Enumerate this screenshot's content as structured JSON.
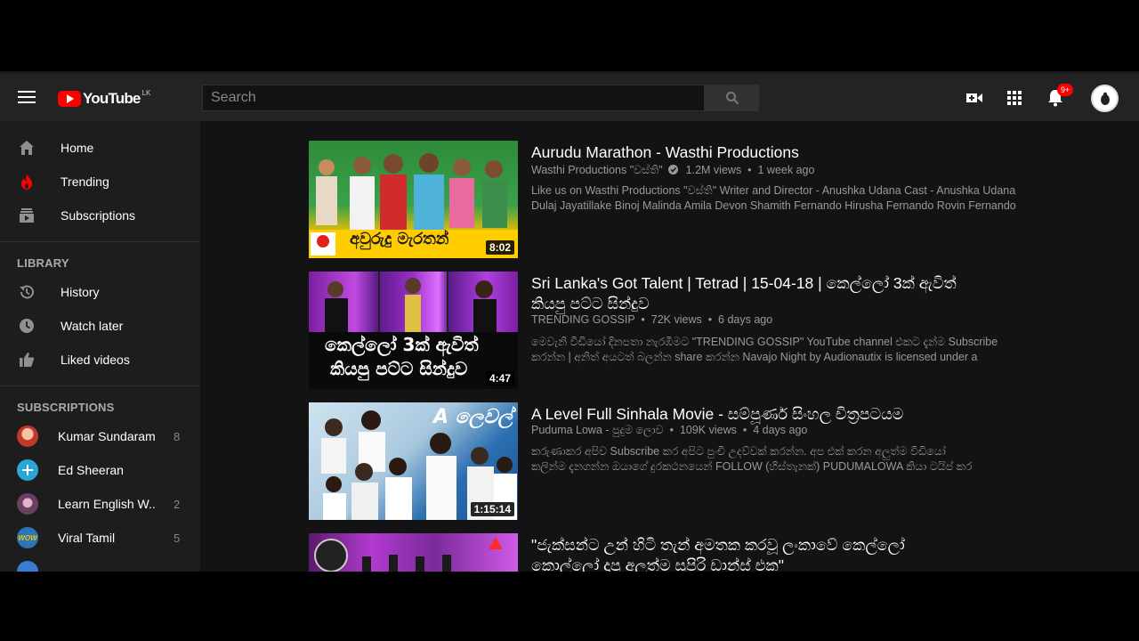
{
  "masthead": {
    "logo_text": "YouTube",
    "country": "LK",
    "search_placeholder": "Search",
    "notification_count": "9+"
  },
  "sidebar": {
    "main_items": [
      {
        "label": "Home",
        "icon": "home-icon"
      },
      {
        "label": "Trending",
        "icon": "flame-icon"
      },
      {
        "label": "Subscriptions",
        "icon": "subscriptions-icon"
      }
    ],
    "library_heading": "LIBRARY",
    "library_items": [
      {
        "label": "History",
        "icon": "history-icon"
      },
      {
        "label": "Watch later",
        "icon": "clock-icon"
      },
      {
        "label": "Liked videos",
        "icon": "thumbs-up-icon"
      }
    ],
    "subscriptions_heading": "SUBSCRIPTIONS",
    "subscriptions": [
      {
        "label": "Kumar Sundaram",
        "count": "8",
        "color": "#d9534f"
      },
      {
        "label": "Ed Sheeran",
        "count": "",
        "color": "#2aa6d8"
      },
      {
        "label": "Learn English W...",
        "count": "2",
        "color": "#7a4f6f"
      },
      {
        "label": "Viral Tamil",
        "count": "5",
        "color": "#f2c500"
      }
    ]
  },
  "videos": [
    {
      "title_line1": "Aurudu Marathon - Wasthi Productions",
      "title_line2": "",
      "channel": "Wasthi Productions \"වස්ති\"",
      "verified": true,
      "views": "1.2M views",
      "age": "1 week ago",
      "desc_line1": "Like us on Wasthi Productions \"වස්ති\" Writer and Director - Anushka Udana Cast - Anushka Udana",
      "desc_line2": "Dulaj Jayatillake Binoj Malinda Amila Devon Shamith Fernando Hirusha Fernando Rovin Fernando",
      "duration": "8:02",
      "thumb_caption": "අවුරුදු මැරතන්"
    },
    {
      "title_line1": "Sri Lanka's Got Talent | Tetrad | 15-04-18 | කෙල්ලෝ 3ක් ඇවිත්",
      "title_line2": "කියපු පට්ට සින්දුව",
      "channel": "TRENDING GOSSIP",
      "verified": false,
      "views": "72K views",
      "age": "6 days ago",
      "desc_line1": "මෙවැනි වීඩියෝ දිනපතා නැරඹීමට \"TRENDING GOSSIP\" YouTube channel එකට දැන්ම Subscribe",
      "desc_line2": "කරන්න | අනිත් අයටත් බලන්න share කරන්න Navajo Night by Audionautix is licensed under a",
      "duration": "4:47",
      "thumb_caption_1": "කෙල්ලෝ 3ක් ඇවිත්",
      "thumb_caption_2": "කියපු පට්ට සින්දුව"
    },
    {
      "title_line1": "A Level Full Sinhala Movie - සම්පූර්ණ සිංහල චිත්‍රපටයම",
      "title_line2": "",
      "channel": "Puduma Lowa - පුදුම ලොව",
      "verified": false,
      "views": "109K views",
      "age": "4 days ago",
      "desc_line1": "කරුණාකර අපිව Subscribe කර අපිට පුංචි උදව්වක් කරන්න. අප එක් කරන අලුත්ම වීඩියෝ",
      "desc_line2": "කලින්ම දැනගන්න ඔයාගේ දුරකථනයෙන් FOLLOW (හිස්තැනක්) PUDUMALOWA කියා ටයිප් කර",
      "duration": "1:15:14",
      "thumb_caption": "A ලෙවල්"
    },
    {
      "title_line1": "\"ජැක්සන්ට උන් හිටි තැන් අමතක කරවූ ලංකාවේ කෙල්ලෝ",
      "title_line2": "කොල්ලෝ දාපු අලුත්ම සුපිරි ඩාන්ස් එක\"",
      "channel": "",
      "views": "",
      "age": "",
      "desc_line1": "",
      "desc_line2": "",
      "duration": ""
    }
  ]
}
